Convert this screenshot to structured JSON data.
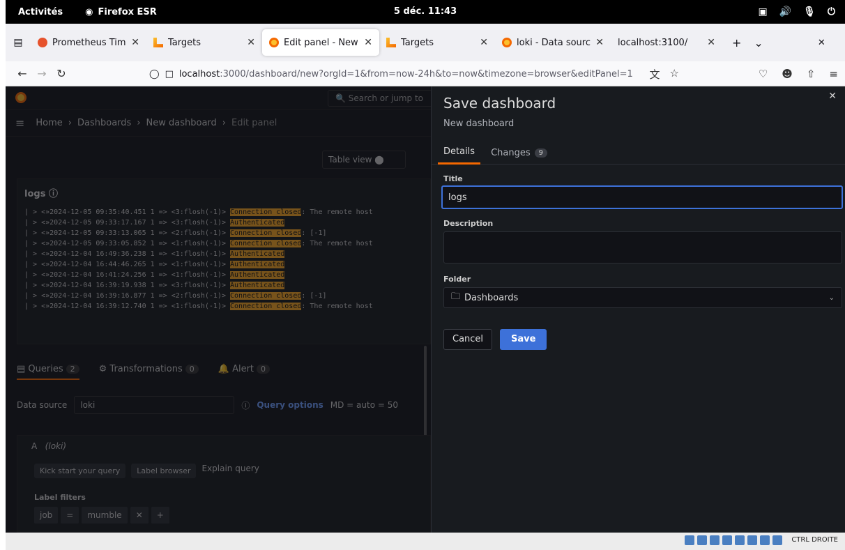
{
  "gnome": {
    "activities": "Activités",
    "app_name": "Firefox ESR",
    "clock": "5 déc. 11:43",
    "tray_label": "CTRL DROITE"
  },
  "browser": {
    "tabs": [
      {
        "title": "Prometheus Time Se",
        "favicon": "prometheus-icon"
      },
      {
        "title": "Targets",
        "favicon": "loki-icon"
      },
      {
        "title": "Edit panel - New da",
        "favicon": "grafana-icon",
        "active": true
      },
      {
        "title": "Targets",
        "favicon": "loki-icon"
      },
      {
        "title": "loki - Data sources",
        "favicon": "grafana-icon"
      },
      {
        "title": "localhost:3100/",
        "favicon": ""
      }
    ],
    "url_host": "localhost",
    "url_rest": ":3000/dashboard/new?orgId=1&from=now-24h&to=now&timezone=browser&editPanel=1"
  },
  "grafana": {
    "search_placeholder": "Search or jump to",
    "breadcrumb": [
      "Home",
      "Dashboards",
      "New dashboard",
      "Edit panel"
    ],
    "table_view": "Table view",
    "panel_title": "logs",
    "log_lines": [
      {
        "prefix": "> <»2024-12-05 09:35:40.451 1 => <3:flosh(-1)> ",
        "hl": "Connection closed",
        "suffix": ": The remote host"
      },
      {
        "prefix": "> <»2024-12-05 09:33:17.167 1 => <3:flosh(-1)> ",
        "hl": "Authenticated",
        "suffix": ""
      },
      {
        "prefix": "> <»2024-12-05 09:33:13.065 1 => <2:flosh(-1)> ",
        "hl": "Connection closed",
        "suffix": ":  [-1]"
      },
      {
        "prefix": "> <»2024-12-05 09:33:05.852 1 => <1:flosh(-1)> ",
        "hl": "Connection closed",
        "suffix": ": The remote host"
      },
      {
        "prefix": "> <»2024-12-04 16:49:36.238 1 => <1:flosh(-1)> ",
        "hl": "Authenticated",
        "suffix": ""
      },
      {
        "prefix": "> <»2024-12-04 16:44:46.265 1 => <1:flosh(-1)> ",
        "hl": "Authenticated",
        "suffix": ""
      },
      {
        "prefix": "> <»2024-12-04 16:41:24.256 1 => <1:flosh(-1)> ",
        "hl": "Authenticated",
        "suffix": ""
      },
      {
        "prefix": "> <»2024-12-04 16:39:19.938 1 => <3:flosh(-1)> ",
        "hl": "Authenticated",
        "suffix": ""
      },
      {
        "prefix": "> <»2024-12-04 16:39:16.877 1 => <2:flosh(-1)> ",
        "hl": "Connection closed",
        "suffix": ":  [-1]"
      },
      {
        "prefix": "> <»2024-12-04 16:39:12.740 1 => <1:flosh(-1)> ",
        "hl": "Connection closed",
        "suffix": ": The remote host"
      }
    ],
    "tabs": {
      "queries": "Queries",
      "queries_count": "2",
      "transformations": "Transformations",
      "transformations_count": "0",
      "alert": "Alert",
      "alert_count": "0"
    },
    "data_source_label": "Data source",
    "data_source_value": "loki",
    "query_options": "Query options",
    "query_options_meta": "MD = auto = 50",
    "query_letter": "A",
    "query_ds": "(loki)",
    "kick_start": "Kick start your query",
    "label_browser": "Label browser",
    "explain_query": "Explain query",
    "label_filters": "Label filters",
    "filter": {
      "key": "job",
      "op": "=",
      "value": "mumble"
    }
  },
  "drawer": {
    "title": "Save dashboard",
    "subtitle": "New dashboard",
    "tab_details": "Details",
    "tab_changes": "Changes",
    "changes_count": "9",
    "title_label": "Title",
    "title_value": "logs",
    "description_label": "Description",
    "folder_label": "Folder",
    "folder_value": "Dashboards",
    "cancel": "Cancel",
    "save": "Save"
  },
  "colors": {
    "accent_orange": "#f46800",
    "primary_blue": "#3d71d9",
    "log_highlight": "#f5a623"
  }
}
